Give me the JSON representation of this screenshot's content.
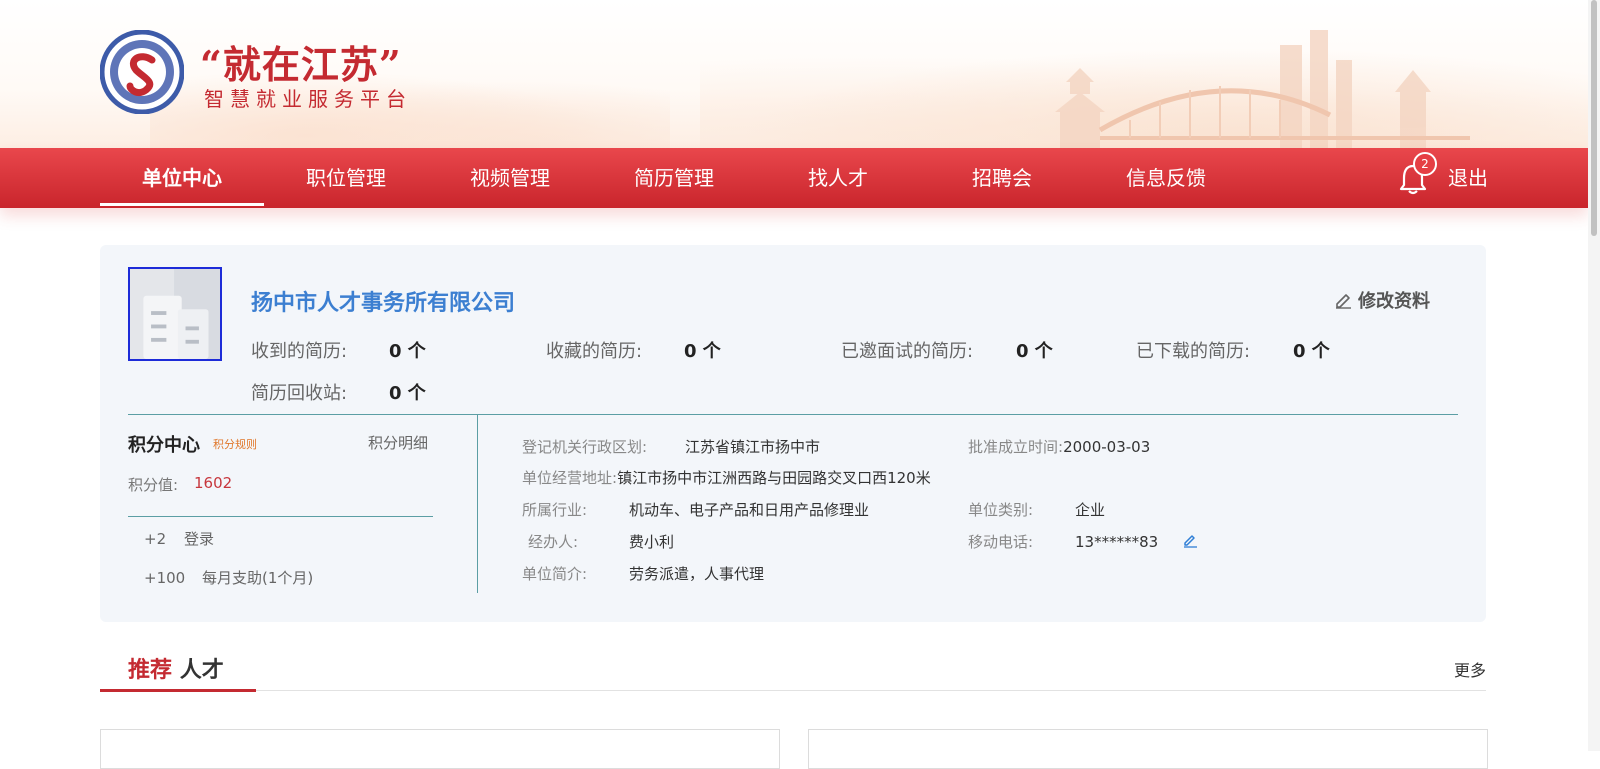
{
  "header": {
    "slogan": "“就在江苏”",
    "subslogan": "智慧就业服务平台"
  },
  "nav": {
    "items": [
      {
        "label": "单位中心",
        "active": true
      },
      {
        "label": "职位管理",
        "active": false
      },
      {
        "label": "视频管理",
        "active": false
      },
      {
        "label": "简历管理",
        "active": false
      },
      {
        "label": "找人才",
        "active": false
      },
      {
        "label": "招聘会",
        "active": false
      },
      {
        "label": "信息反馈",
        "active": false
      }
    ],
    "notification_count": "2",
    "logout_label": "退出"
  },
  "company": {
    "name": "扬中市人才事务所有限公司",
    "edit_label": "修改资料",
    "stats": [
      {
        "label": "收到的简历:",
        "value": "0 个"
      },
      {
        "label": "收藏的简历:",
        "value": "0 个"
      },
      {
        "label": "已邀面试的简历:",
        "value": "0 个"
      },
      {
        "label": "已下载的简历:",
        "value": "0 个"
      },
      {
        "label": "简历回收站:",
        "value": "0 个"
      }
    ]
  },
  "points": {
    "title": "积分中心",
    "rule_label": "积分规则",
    "detail_label": "积分明细",
    "value_label": "积分值:",
    "value": "1602",
    "records": [
      {
        "amount": "+2",
        "desc": "登录"
      },
      {
        "amount": "+100",
        "desc": "每月支助(1个月)"
      }
    ]
  },
  "info": {
    "region_label": "登记机关行政区划:",
    "region": "江苏省镇江市扬中市",
    "founded_label": "批准成立时间:",
    "founded": "2000-03-03",
    "address_label": "单位经营地址:",
    "address": "镇江市扬中市江洲西路与田园路交叉口西120米",
    "industry_label": "所属行业:",
    "industry": "机动车、电子产品和日用产品修理业",
    "type_label": "单位类别:",
    "type": "企业",
    "contact_label": "经办人:",
    "contact": "费小利",
    "phone_label": "移动电话:",
    "phone": "13******83",
    "intro_label": "单位简介:",
    "intro": "劳务派遣，人事代理"
  },
  "recommend": {
    "title_red": "推荐",
    "title_dark": "人才",
    "more_label": "更多"
  },
  "colors": {
    "brand_red": "#c42a31",
    "nav_top": "#e9474c",
    "nav_bottom": "#c9252c",
    "company_blue": "#3c7fd1",
    "divider_teal": "#5b9ea4",
    "rule_orange": "#e0772a"
  }
}
